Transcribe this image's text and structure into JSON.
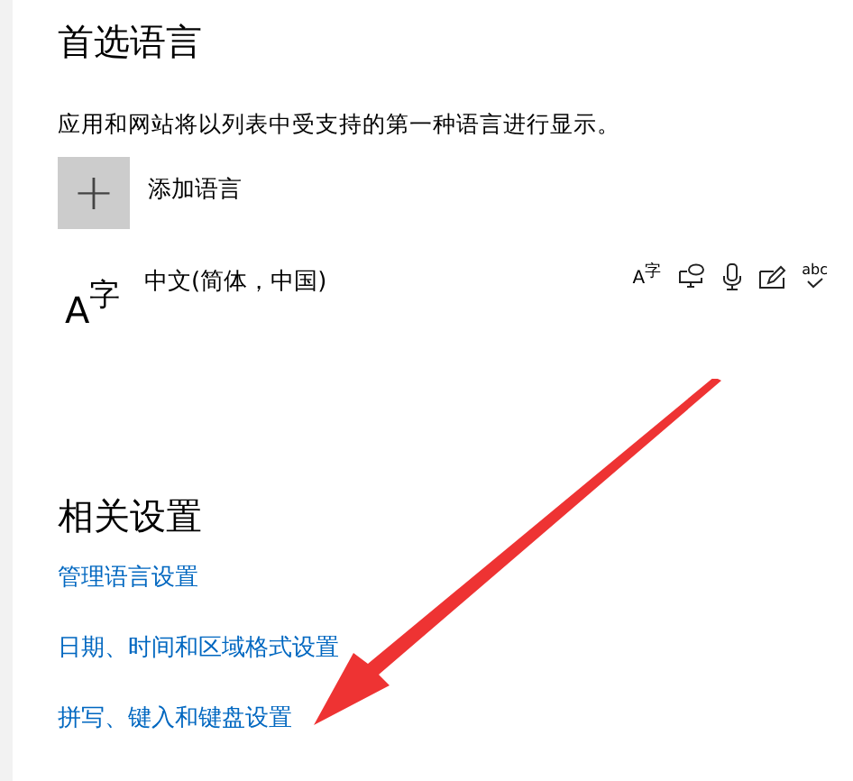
{
  "preferred_languages": {
    "title": "首选语言",
    "description": "应用和网站将以列表中受支持的第一种语言进行显示。",
    "add_button": {
      "icon": "+",
      "label": "添加语言"
    },
    "languages": [
      {
        "icon": "A$^{字}$",
        "name": "中文(简体，中国)",
        "features": [
          {
            "kind": "font",
            "glyph": "A$^{字}$"
          },
          {
            "kind": "speech"
          },
          {
            "kind": "voice"
          },
          {
            "kind": "handwriting"
          },
          {
            "kind": "spelling",
            "glyph": "abc"
          }
        ]
      }
    ]
  },
  "related_settings": {
    "title": "相关设置",
    "links": [
      "管理语言设置",
      "日期、时间和区域格式设置",
      "拼写、键入和键盘设置"
    ]
  },
  "annotation": {
    "kind": "arrow"
  }
}
